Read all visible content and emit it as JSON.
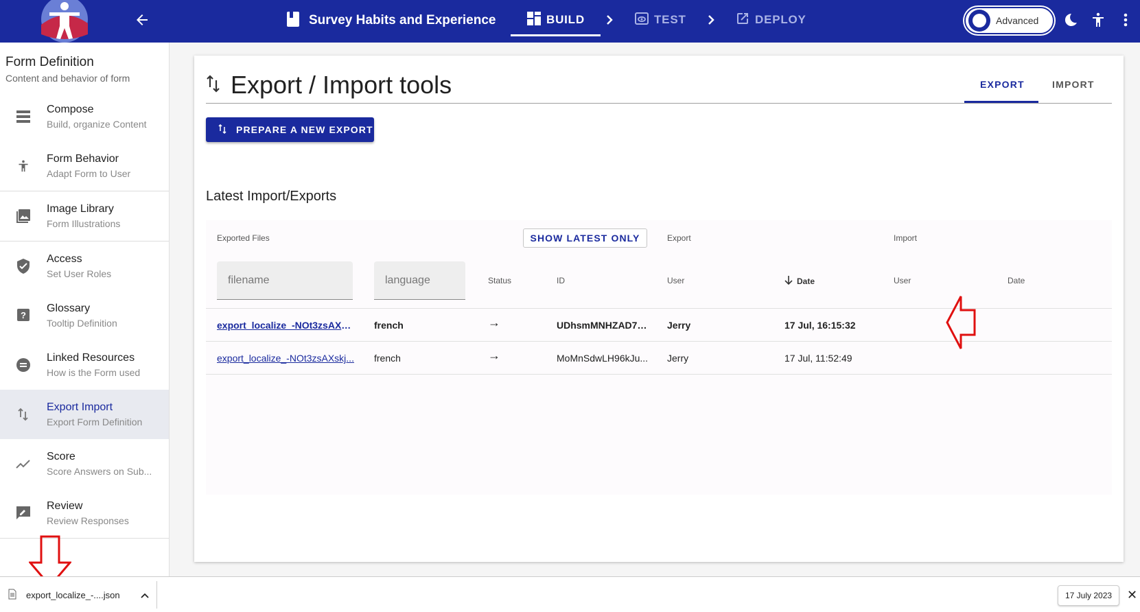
{
  "header": {
    "form_title": "Survey Habits and Experience",
    "steps": {
      "build": "BUILD",
      "test": "TEST",
      "deploy": "DEPLOY"
    },
    "advanced_label": "Advanced"
  },
  "sidebar": {
    "title": "Form Definition",
    "subtitle": "Content and behavior of form",
    "items": [
      {
        "label": "Compose",
        "sub": "Build, organize Content",
        "icon": "compose-icon"
      },
      {
        "label": "Form Behavior",
        "sub": "Adapt Form to User",
        "icon": "accessibility-icon"
      },
      {
        "label": "Image Library",
        "sub": "Form Illustrations",
        "icon": "image-icon"
      },
      {
        "label": "Access",
        "sub": "Set User Roles",
        "icon": "shield-icon"
      },
      {
        "label": "Glossary",
        "sub": "Tooltip Definition",
        "icon": "help-icon"
      },
      {
        "label": "Linked Resources",
        "sub": "How is the Form used",
        "icon": "link-icon"
      },
      {
        "label": "Export Import",
        "sub": "Export Form Definition",
        "icon": "swap-icon",
        "active": true
      },
      {
        "label": "Score",
        "sub": "Score Answers on Sub...",
        "icon": "trend-icon"
      },
      {
        "label": "Review",
        "sub": "Review Responses",
        "icon": "review-icon"
      }
    ]
  },
  "main": {
    "title": "Export / Import tools",
    "tabs": {
      "export": "EXPORT",
      "import": "IMPORT"
    },
    "prepare_button": "PREPARE A NEW EXPORT",
    "section_title": "Latest Import/Exports",
    "table": {
      "group_headers": {
        "exported_files": "Exported Files",
        "export": "Export",
        "import": "Import"
      },
      "show_latest_button": "SHOW LATEST ONLY",
      "filters": {
        "filename_placeholder": "filename",
        "language_placeholder": "language"
      },
      "columns": {
        "status": "Status",
        "id": "ID",
        "export_user": "User",
        "export_date": "Date",
        "import_user": "User",
        "import_date": "Date"
      },
      "rows": [
        {
          "filename": "export_localize_-NOt3zsAXsk...",
          "language": "french",
          "status": "→",
          "id": "UDhsmMNHZAD7c...",
          "user": "Jerry",
          "date": "17 Jul, 16:15:32",
          "bold": true
        },
        {
          "filename": "export_localize_-NOt3zsAXskj...",
          "language": "french",
          "status": "→",
          "id": "MoMnSdwLH96kJu...",
          "user": "Jerry",
          "date": "17 Jul, 11:52:49",
          "bold": false
        }
      ]
    }
  },
  "download_bar": {
    "file_name": "export_localize_-....json",
    "date_chip": "17 July 2023",
    "close": "✕"
  },
  "colors": {
    "primary": "#1a2a9e",
    "annotation": "#e01010"
  }
}
